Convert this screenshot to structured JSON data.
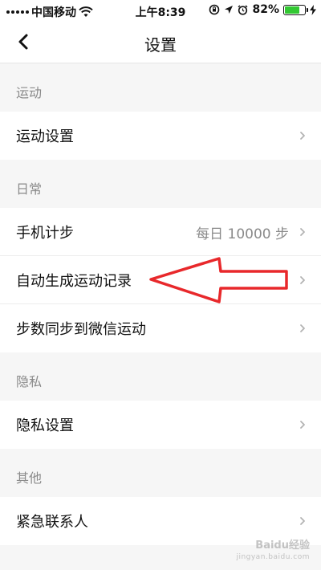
{
  "status_bar": {
    "carrier": "中国移动",
    "time": "上午8:39",
    "battery_percent": "82%",
    "battery_level": 0.82,
    "battery_color": "#32c832",
    "icons": [
      "signal-icon",
      "wifi-icon",
      "orientation-lock-icon",
      "location-arrow-icon",
      "alarm-icon",
      "battery-icon",
      "charging-bolt-icon"
    ]
  },
  "nav": {
    "title": "设置",
    "back_icon": "chevron-left-icon"
  },
  "sections": [
    {
      "header": "运动",
      "rows": [
        {
          "label": "运动设置",
          "value": ""
        }
      ]
    },
    {
      "header": "日常",
      "rows": [
        {
          "label": "手机计步",
          "value": "每日 10000 步"
        },
        {
          "label": "自动生成运动记录",
          "value": ""
        },
        {
          "label": "步数同步到微信运动",
          "value": ""
        }
      ]
    },
    {
      "header": "隐私",
      "rows": [
        {
          "label": "隐私设置",
          "value": ""
        }
      ]
    },
    {
      "header": "其他",
      "rows": [
        {
          "label": "紧急联系人",
          "value": ""
        }
      ]
    }
  ],
  "annotation": {
    "color": "#e8282b"
  },
  "watermark": {
    "text": "Baidu经验",
    "sub": "jingyan.baidu.com"
  }
}
